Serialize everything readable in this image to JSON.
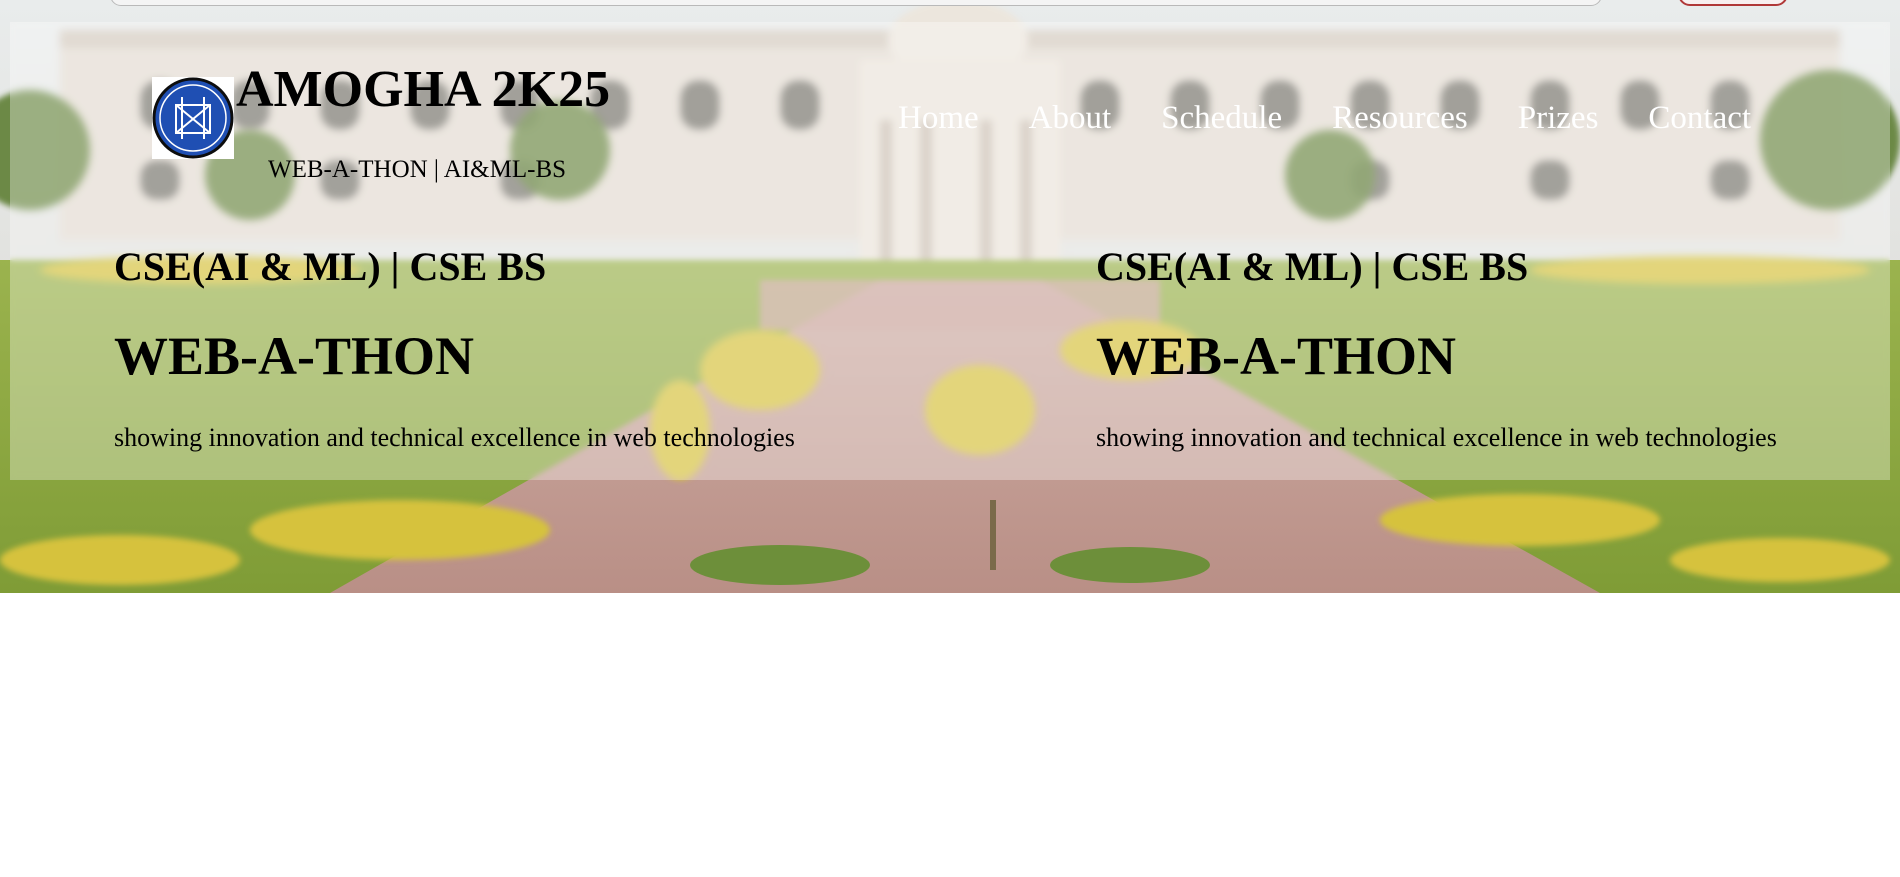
{
  "brand": {
    "title": "AMOGHA 2K25",
    "subtitle": "WEB-A-THON | AI&ML-BS",
    "logo_icon": "college-emblem-icon"
  },
  "nav": {
    "items": [
      {
        "label": "Home"
      },
      {
        "label": "About"
      },
      {
        "label": "Schedule"
      },
      {
        "label": "Resources"
      },
      {
        "label": "Prizes"
      },
      {
        "label": "Contact"
      }
    ]
  },
  "hero": {
    "columns": [
      {
        "dept": "CSE(AI & ML) | CSE BS",
        "event": "WEB-A-THON",
        "tagline": "showing innovation and technical excellence in web technologies"
      },
      {
        "dept": "CSE(AI & ML) | CSE BS",
        "event": "WEB-A-THON",
        "tagline": "showing innovation and technical excellence in web technologies"
      }
    ]
  },
  "colors": {
    "nav_text": "#ffffff",
    "logo_blue": "#1f4fb3",
    "grass": "#8fae3c",
    "path": "#c9a39a"
  }
}
